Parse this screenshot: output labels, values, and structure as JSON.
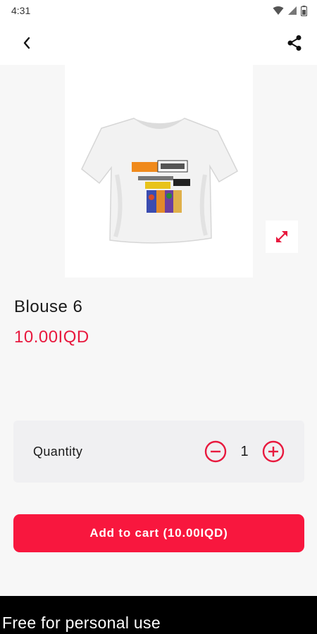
{
  "status_bar": {
    "time": "4:31"
  },
  "product": {
    "name": "Blouse 6",
    "price": "10.00IQD",
    "image_icon": "tshirt-photo"
  },
  "quantity": {
    "label": "Quantity",
    "value": "1"
  },
  "actions": {
    "add_to_cart": "Add to cart (10.00IQD)"
  },
  "footer": {
    "watermark": "Free for personal use"
  },
  "colors": {
    "accent": "#f8173e",
    "price": "#e8193e",
    "card": "#f0f0f2",
    "background": "#f7f7f7"
  }
}
